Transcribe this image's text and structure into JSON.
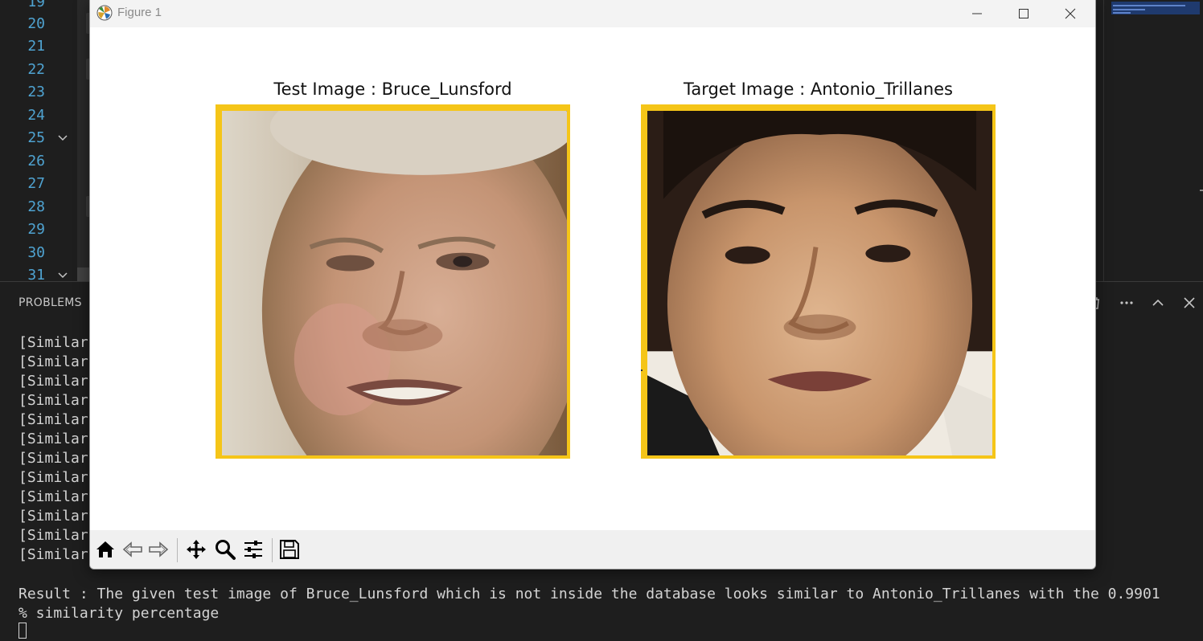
{
  "editor": {
    "line_numbers": [
      "19",
      "20",
      "21",
      "22",
      "23",
      "24",
      "25",
      "26",
      "27",
      "28",
      "29",
      "30",
      "31"
    ]
  },
  "panel": {
    "tab_label": "PROBLEMS",
    "terminal_lines": [
      "[Similar",
      "[Similar",
      "[Similar",
      "[Similar",
      "[Similar",
      "[Similar",
      "[Similar",
      "[Similar",
      "[Similar",
      "[Similar",
      "[Similar",
      "[Similar"
    ],
    "result_line_1": "Result : The given test image of Bruce_Lunsford which is not inside the database looks similar to Antonio_Trillanes with the 0.9901",
    "result_line_2": "% similarity percentage",
    "actions": [
      "trash-icon",
      "more-icon",
      "chevron-up-icon",
      "close-icon"
    ]
  },
  "figure_window": {
    "title": "Figure 1",
    "left_axes_title": "Test Image : Bruce_Lunsford",
    "right_axes_title": "Target Image : Antonio_Trillanes",
    "frame_color": "#f5c518",
    "toolbar_icons": [
      "home-icon",
      "back-icon",
      "forward-icon",
      "pan-icon",
      "zoom-icon",
      "configure-subplots-icon",
      "save-icon"
    ]
  }
}
